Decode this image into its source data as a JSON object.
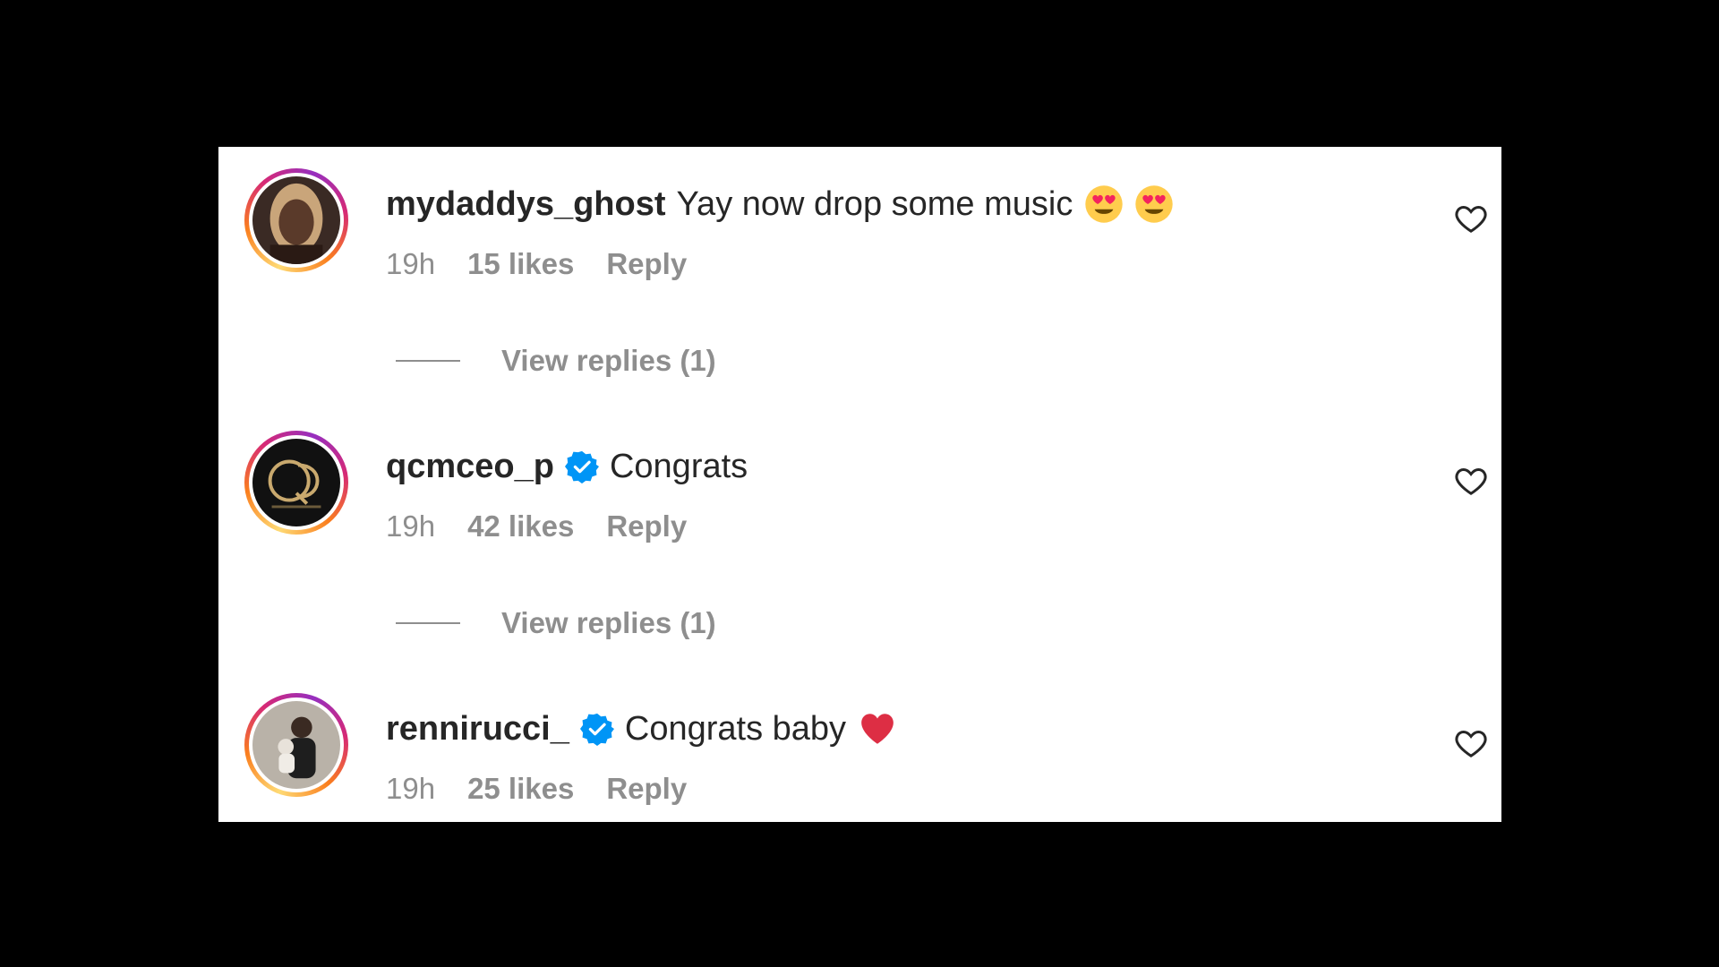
{
  "colors": {
    "background": "#000000",
    "panel": "#ffffff",
    "primary_text": "#262626",
    "secondary_text": "#8e8e8e",
    "verified_blue": "#0095f6",
    "heart_red": "#ed4956"
  },
  "comments": [
    {
      "username": "mydaddys_ghost",
      "verified": false,
      "text": "Yay now drop some music",
      "emojis": [
        "smiling-face-with-heart-eyes",
        "smiling-face-with-heart-eyes"
      ],
      "time": "19h",
      "likes": "15 likes",
      "reply_label": "Reply",
      "view_replies": "View replies (1)"
    },
    {
      "username": "qcmceo_p",
      "verified": true,
      "text": "Congrats",
      "emojis": [],
      "time": "19h",
      "likes": "42 likes",
      "reply_label": "Reply",
      "view_replies": "View replies (1)"
    },
    {
      "username": "rennirucci_",
      "verified": true,
      "text": "Congrats baby",
      "emojis": [
        "red-heart"
      ],
      "time": "19h",
      "likes": "25 likes",
      "reply_label": "Reply"
    }
  ]
}
